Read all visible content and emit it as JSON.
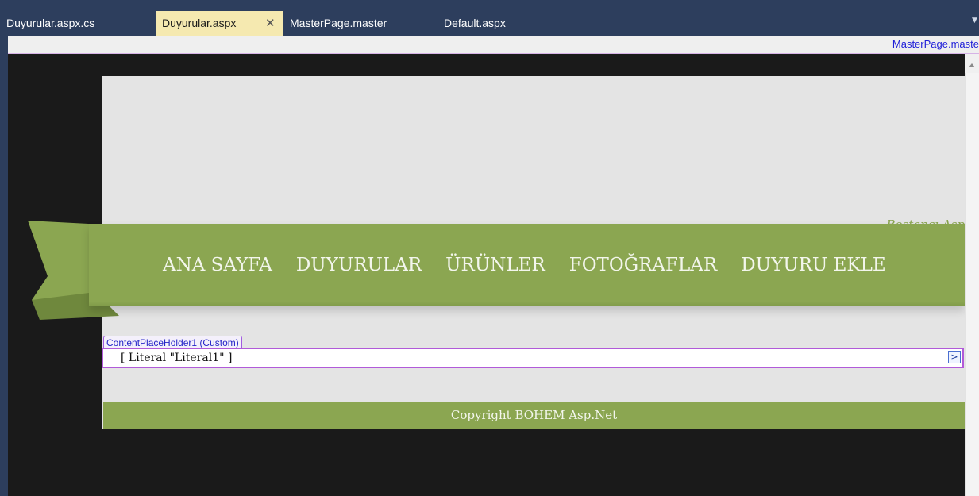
{
  "tabs": [
    {
      "label": "Duyurular.aspx.cs",
      "active": false
    },
    {
      "label": "Duyurular.aspx",
      "active": true,
      "close": "✕"
    },
    {
      "label": "MasterPage.master",
      "active": false
    },
    {
      "label": "Default.aspx",
      "active": false
    }
  ],
  "tab_overflow_icon": "dropdown-arrow-icon",
  "breadcrumb": "MasterPage.maste",
  "design": {
    "brand_text": "Bostancı Asp",
    "nav": [
      "ANA SAYFA",
      "DUYURULAR",
      "ÜRÜNLER",
      "FOTOĞRAFLAR",
      "DUYURU EKLE"
    ],
    "content_placeholder_label": "ContentPlaceHolder1 (Custom)",
    "literal_text": "[ Literal \"Literal1\" ]",
    "smart_tag": ">",
    "footer_text": "Copyright BOHEM Asp.Net"
  },
  "colors": {
    "accent_green": "#8ba651",
    "tab_active": "#f5e9b0",
    "tab_strip": "#2d3e5d",
    "placeholder_border": "#b15ad9"
  }
}
